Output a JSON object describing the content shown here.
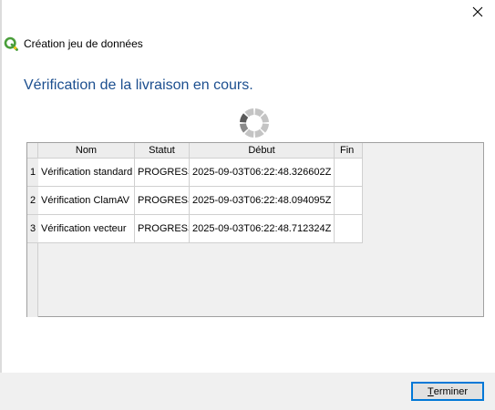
{
  "window": {
    "title": "Création jeu de données",
    "close_icon": "close-icon",
    "app_icon": "qgis-logo-icon"
  },
  "page": {
    "heading": "Vérification de la livraison en cours.",
    "spinner_icon": "loading-spinner-icon"
  },
  "table": {
    "columns": [
      "Nom",
      "Statut",
      "Début",
      "Fin"
    ],
    "rows": [
      {
        "num": "1",
        "nom": "Vérification standard",
        "statut": "PROGRESS",
        "debut": "2025-09-03T06:22:48.326602Z",
        "fin": ""
      },
      {
        "num": "2",
        "nom": "Vérification ClamAV",
        "statut": "PROGRESS",
        "debut": "2025-09-03T06:22:48.094095Z",
        "fin": ""
      },
      {
        "num": "3",
        "nom": "Vérification vecteur",
        "statut": "PROGRESS",
        "debut": "2025-09-03T06:22:48.712324Z",
        "fin": ""
      }
    ]
  },
  "footer": {
    "finish_label_first": "T",
    "finish_label_rest": "erminer"
  },
  "colors": {
    "heading": "#1c4f8f",
    "qgis_green": "#4a9e3b",
    "qgis_yellow": "#f0c419",
    "button_focus": "#0078d7"
  }
}
